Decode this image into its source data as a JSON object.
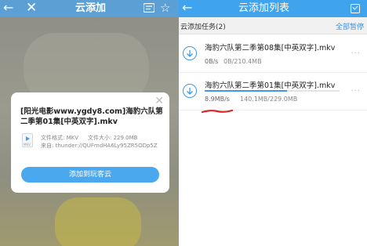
{
  "left": {
    "header": {
      "back_icon": "back-arrow-icon",
      "close_icon": "close-icon",
      "title": "云添加",
      "menu_icon": "list-menu-icon",
      "star_icon": "star-icon"
    },
    "dialog": {
      "file_name": "[阳光电影www.ygdy8.com]海豹六队第二季第01集[中英双字].mkv",
      "format_label": "文件格式: MKV",
      "size_label": "文件大小: 229.0MB",
      "source_label": "来自: thunder://QUFmdHA6Ly95ZR5ODp5Z",
      "file_icon_ext": "MKV",
      "add_button": "添加到玩客云"
    }
  },
  "right": {
    "header": {
      "title": "云添加列表",
      "check_icon": "select-all-icon"
    },
    "subbar": {
      "count_label": "云添加任务(2)",
      "pause_all": "全部暂停"
    },
    "tasks": [
      {
        "name": "海豹六队第二季第08集[中英双字].mkv",
        "speed": "0B/s",
        "size": "0B/210.4MB",
        "progress": 0.0
      },
      {
        "name": "海豹六队第二季第01集[中英双字].mkv",
        "speed": "8.9MB/s",
        "size": "140.1MB/229.0MB",
        "progress": 0.61
      }
    ],
    "more_icon": "more-dots-icon",
    "colors": {
      "accent": "#3fa3ee",
      "annotation": "#e02020"
    }
  }
}
